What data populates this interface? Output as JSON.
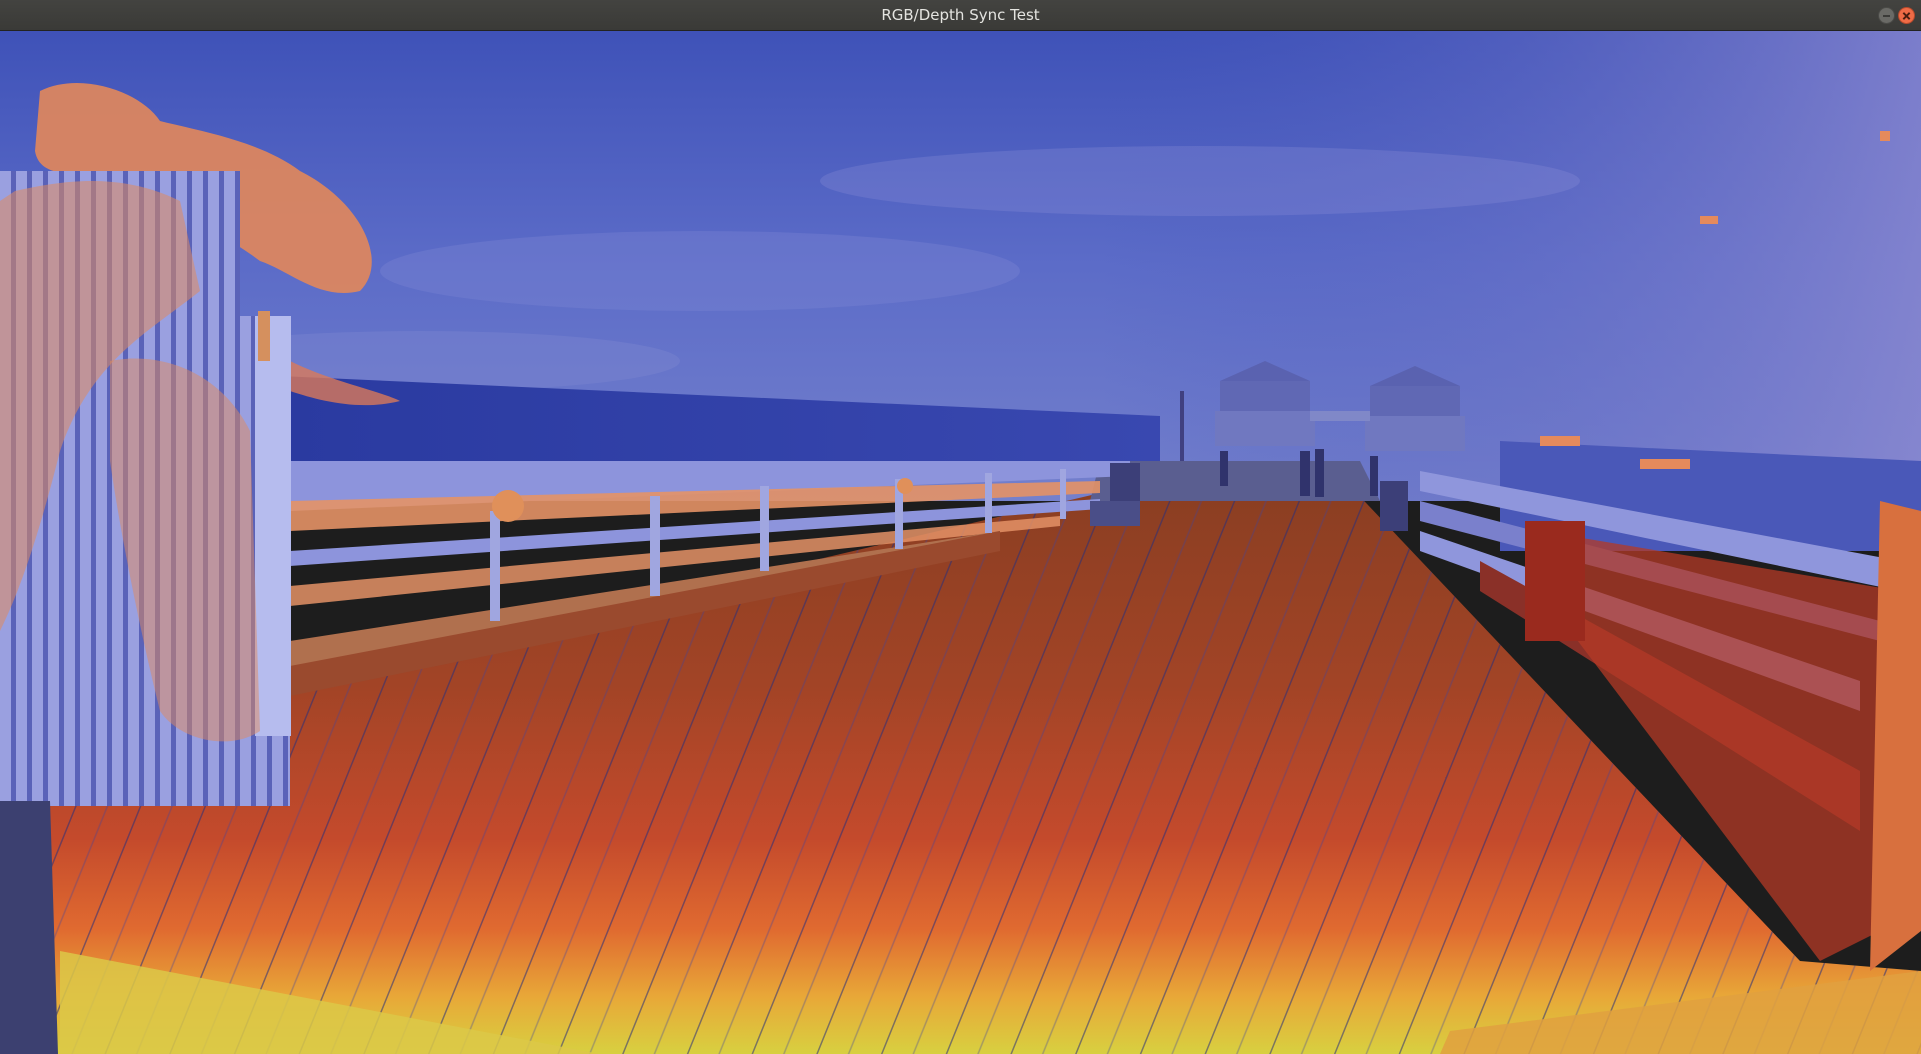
{
  "window": {
    "title": "RGB/Depth Sync Test"
  },
  "controls": {
    "minimize_icon": "minimize-icon",
    "close_icon": "close-icon"
  },
  "scene": {
    "description_colors": {
      "far": "#5a68c8",
      "near_mid": "#c84a2a",
      "near": "#e0d040"
    }
  }
}
